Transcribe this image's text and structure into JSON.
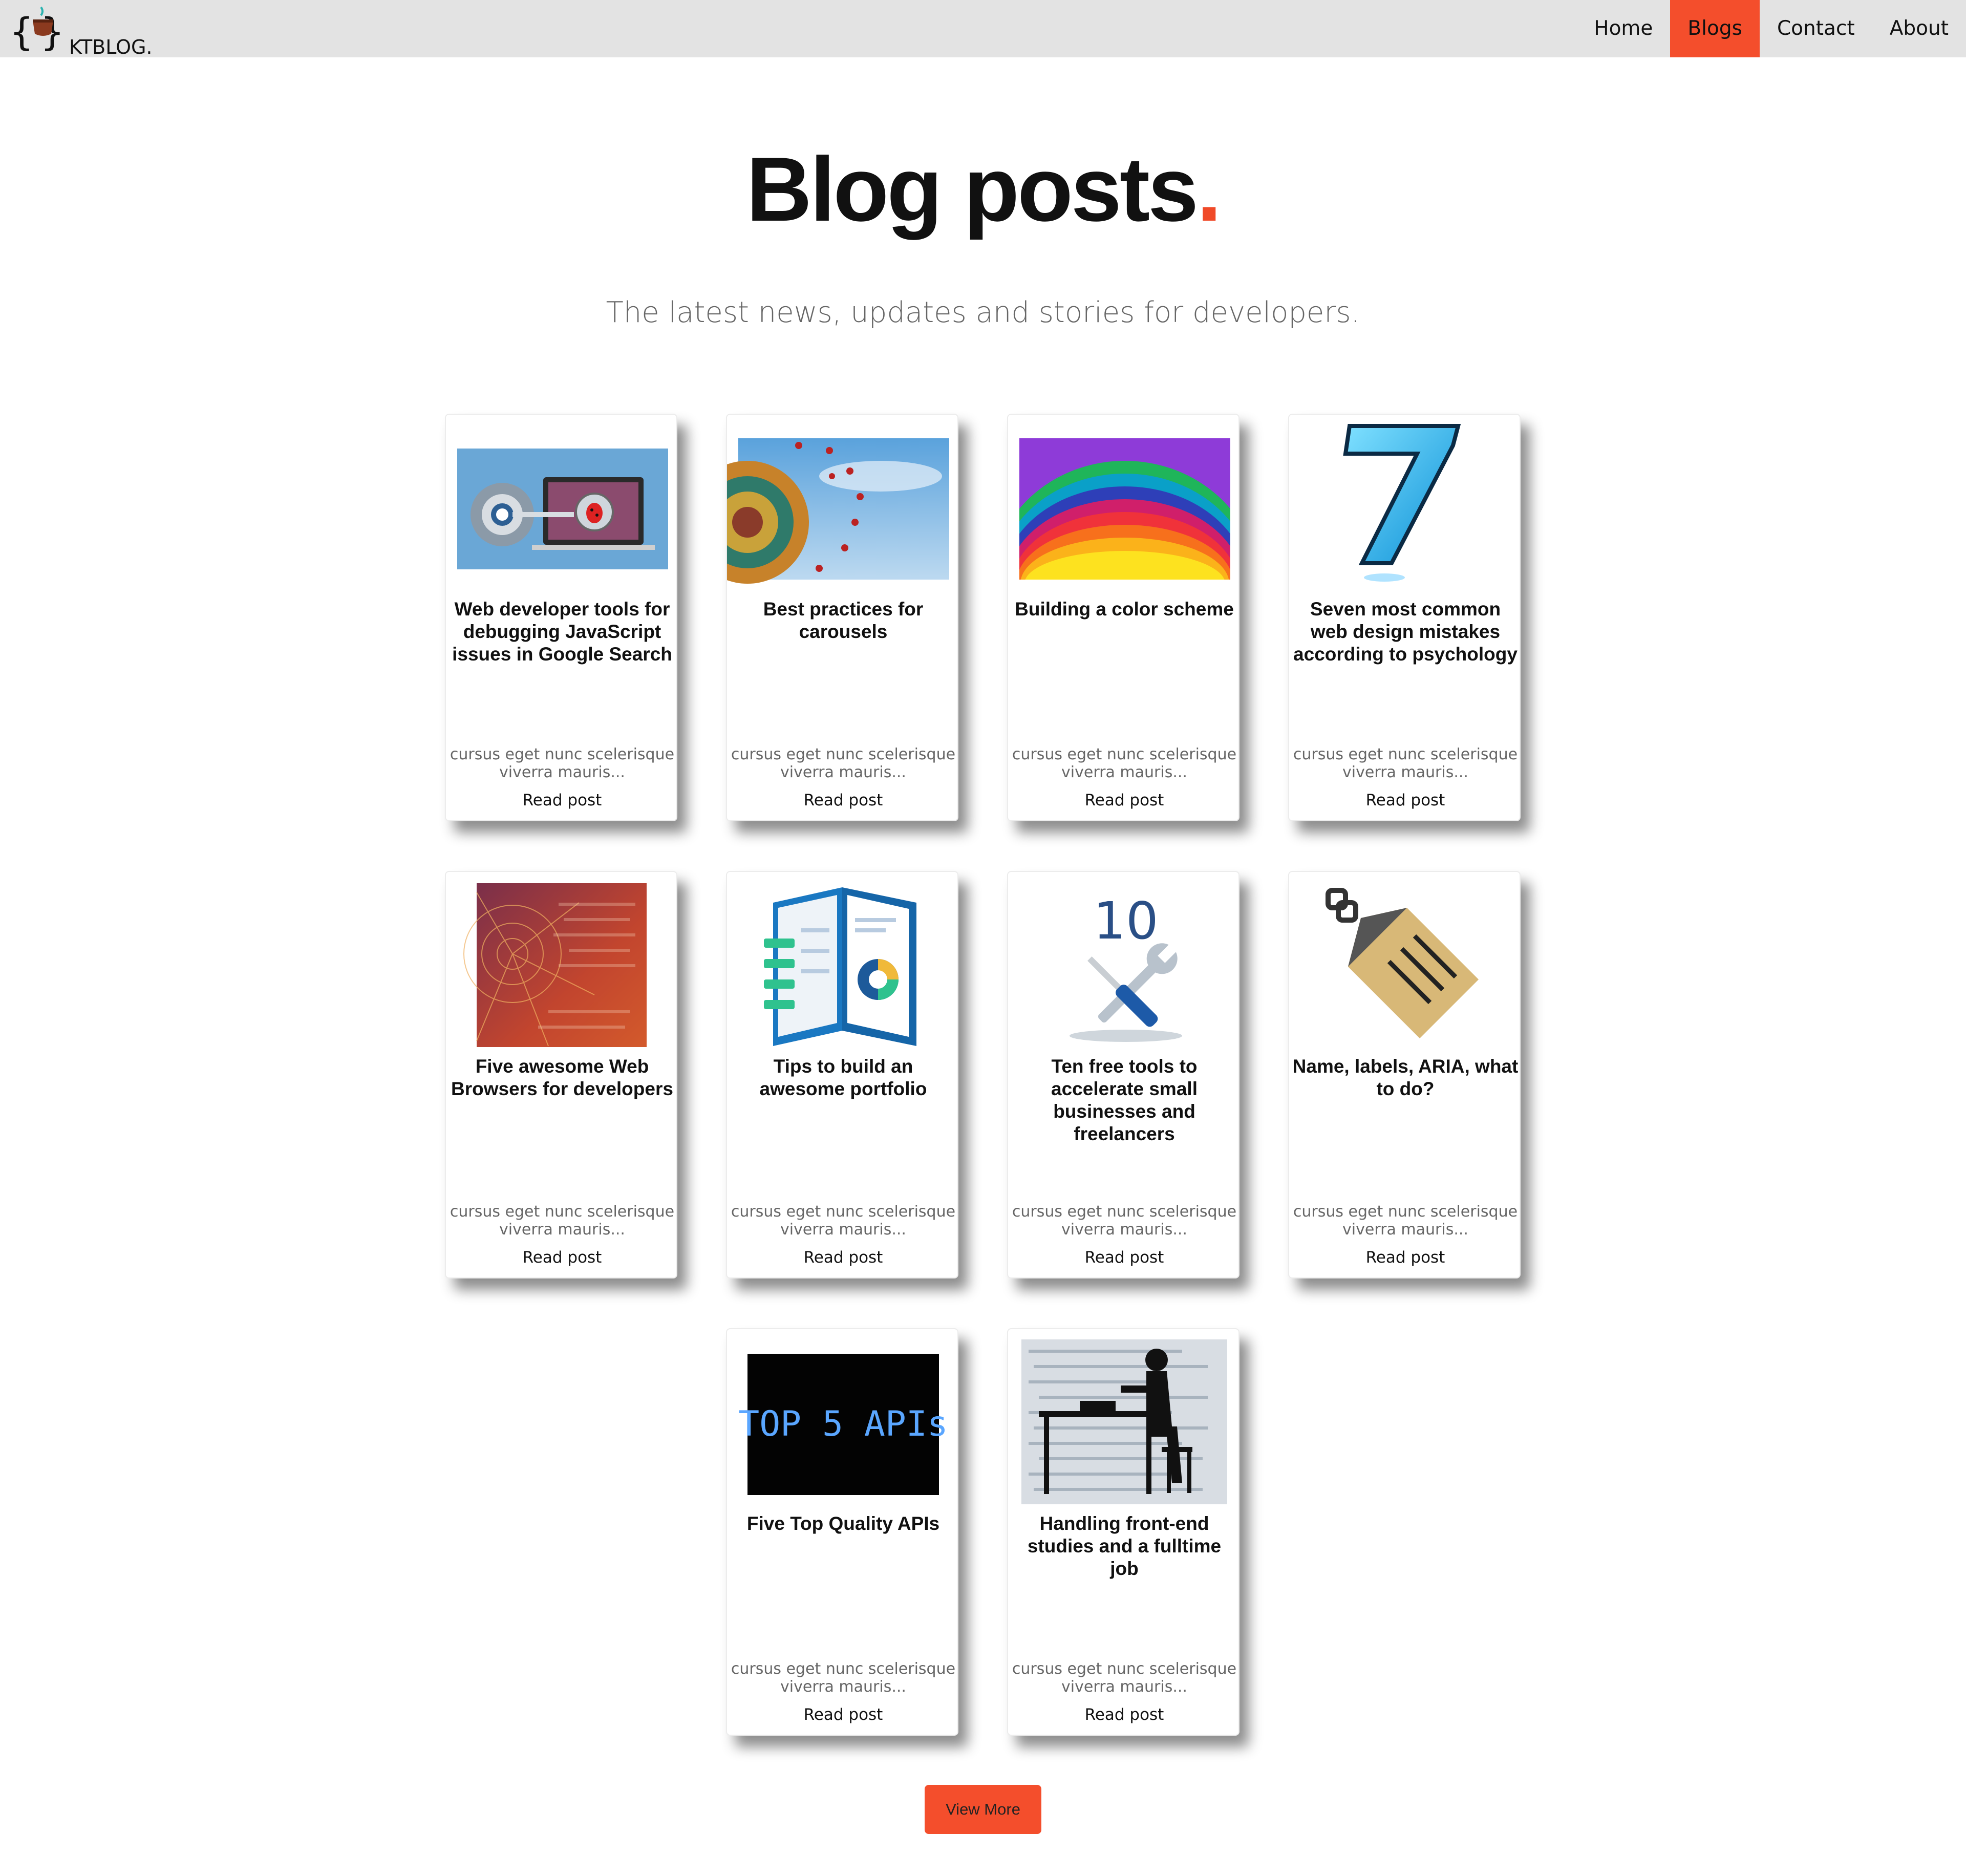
{
  "nav": {
    "logo_text": "KTBLOG.",
    "links": [
      {
        "label": "Home",
        "active": false
      },
      {
        "label": "Blogs",
        "active": true
      },
      {
        "label": "Contact",
        "active": false
      },
      {
        "label": "About",
        "active": false
      }
    ]
  },
  "hero": {
    "title": "Blog posts",
    "title_dot": ".",
    "subtitle": "The latest news, updates and stories for developers."
  },
  "colors": {
    "accent": "#f44e2c",
    "nav_bg": "#e3e3e3"
  },
  "posts": [
    {
      "title": "Web developer tools for debugging JavaScript issues in Google Search",
      "excerpt": "cursus eget nunc scelerisque viverra mauris...",
      "cta": "Read post",
      "image": "debug-tools-image"
    },
    {
      "title": "Best practices for carousels",
      "excerpt": "cursus eget nunc scelerisque viverra mauris...",
      "cta": "Read post",
      "image": "carousel-ride-image"
    },
    {
      "title": "Building a color scheme",
      "excerpt": "cursus eget nunc scelerisque viverra mauris...",
      "cta": "Read post",
      "image": "rainbow-arcs-image"
    },
    {
      "title": "Seven most common web design mistakes according to psychology",
      "excerpt": "cursus eget nunc scelerisque viverra mauris...",
      "cta": "Read post",
      "image": "number-seven-image"
    },
    {
      "title": "Five awesome Web Browsers for developers",
      "excerpt": "cursus eget nunc scelerisque viverra mauris...",
      "cta": "Read post",
      "image": "spider-web-code-image"
    },
    {
      "title": "Tips to build an awesome portfolio",
      "excerpt": "cursus eget nunc scelerisque viverra mauris...",
      "cta": "Read post",
      "image": "portfolio-book-image"
    },
    {
      "title": "Ten free tools to accelerate small businesses and freelancers",
      "excerpt": "cursus eget nunc scelerisque viverra mauris...",
      "cta": "Read post",
      "image": "ten-tools-image",
      "image_text": "10"
    },
    {
      "title": "Name, labels, ARIA, what to do?",
      "excerpt": "cursus eget nunc scelerisque viverra mauris...",
      "cta": "Read post",
      "image": "tag-label-image"
    },
    {
      "title": "Five Top Quality APIs",
      "excerpt": "cursus eget nunc scelerisque viverra mauris...",
      "cta": "Read post",
      "image": "top-apis-image",
      "image_text": "TOP 5 APIs"
    },
    {
      "title": "Handling front-end studies and a fulltime job",
      "excerpt": "cursus eget nunc scelerisque viverra mauris...",
      "cta": "Read post",
      "image": "desk-silhouette-image"
    }
  ],
  "view_more": "View More"
}
